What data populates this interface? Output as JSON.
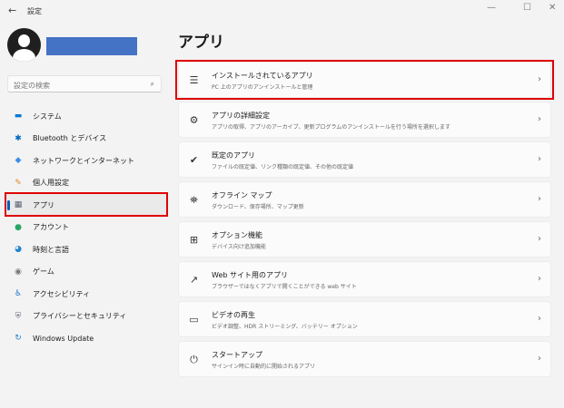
{
  "window": {
    "title": "設定",
    "back": "←",
    "minimize": "—",
    "maximize": "☐",
    "close": "✕"
  },
  "search": {
    "placeholder": "設定の検索",
    "icon": "⌕"
  },
  "sidebar": {
    "items": [
      {
        "label": "システム",
        "icon": "▬",
        "color": "#0078d4"
      },
      {
        "label": "Bluetooth とデバイス",
        "icon": "✱",
        "color": "#0067c0"
      },
      {
        "label": "ネットワークとインターネット",
        "icon": "◆",
        "color": "#3a8ee6"
      },
      {
        "label": "個人用設定",
        "icon": "✎",
        "color": "#e08a2a"
      },
      {
        "label": "アプリ",
        "icon": "▦",
        "color": "#555f70",
        "selected": true
      },
      {
        "label": "アカウント",
        "icon": "●",
        "color": "#2aa563"
      },
      {
        "label": "時刻と言語",
        "icon": "◕",
        "color": "#1a86d0"
      },
      {
        "label": "ゲーム",
        "icon": "◉",
        "color": "#777"
      },
      {
        "label": "アクセシビリティ",
        "icon": "♿",
        "color": "#1a6fd0"
      },
      {
        "label": "プライバシーとセキュリティ",
        "icon": "⛨",
        "color": "#6b7280"
      },
      {
        "label": "Windows Update",
        "icon": "↻",
        "color": "#1a7fd0"
      }
    ]
  },
  "main": {
    "title": "アプリ",
    "cards": [
      {
        "title": "インストールされているアプリ",
        "subtitle": "PC 上のアプリのアンインストールと管理",
        "icon": "☰"
      },
      {
        "title": "アプリの詳細設定",
        "subtitle": "アプリの取得、アプリのアーカイブ、更新プログラムのアンインストールを行う場所を選択します",
        "icon": "⚙"
      },
      {
        "title": "既定のアプリ",
        "subtitle": "ファイルの既定値、リンク種類の既定値、その他の既定値",
        "icon": "✔"
      },
      {
        "title": "オフライン マップ",
        "subtitle": "ダウンロード、保存場所、マップ更新",
        "icon": "⛯"
      },
      {
        "title": "オプション機能",
        "subtitle": "デバイス向け追加機能",
        "icon": "⊞"
      },
      {
        "title": "Web サイト用のアプリ",
        "subtitle": "ブラウザーではなくアプリで開くことができる web サイト",
        "icon": "↗"
      },
      {
        "title": "ビデオの再生",
        "subtitle": "ビデオ調整、HDR ストリーミング、バッテリー オプション",
        "icon": "▭"
      },
      {
        "title": "スタートアップ",
        "subtitle": "サインイン時に自動的に開始されるアプリ",
        "icon": "⏻"
      }
    ],
    "chevron": "›"
  }
}
